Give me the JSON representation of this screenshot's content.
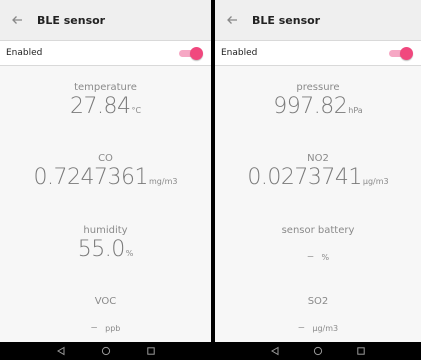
{
  "screens": [
    {
      "appbar": {
        "back_icon": "arrow-left-icon",
        "title": "BLE sensor"
      },
      "enabled": {
        "label": "Enabled",
        "state": "on"
      },
      "readings": [
        {
          "label": "temperature",
          "value": "27.84",
          "unit": "°C"
        },
        {
          "label": "CO",
          "value": "0.7247361",
          "unit": "mg/m3"
        },
        {
          "label": "humidity",
          "value": "55.0",
          "unit": "%"
        },
        {
          "label": "VOC",
          "value": "–",
          "unit": "ppb"
        }
      ]
    },
    {
      "appbar": {
        "back_icon": "arrow-left-icon",
        "title": "BLE sensor"
      },
      "enabled": {
        "label": "Enabled",
        "state": "on"
      },
      "readings": [
        {
          "label": "pressure",
          "value": "997.82",
          "unit": "hPa"
        },
        {
          "label": "NO2",
          "value": "0.0273741",
          "unit": "µg/m3"
        },
        {
          "label": "sensor battery",
          "value": "–",
          "unit": "%"
        },
        {
          "label": "SO2",
          "value": "–",
          "unit": "µg/m3"
        }
      ]
    }
  ],
  "colors": {
    "toggle_thumb": "#f0487e",
    "toggle_track": "#f6a7c4",
    "appbar_bg": "#efefef",
    "content_bg": "#f7f7f7",
    "navbar_bg": "#000000"
  },
  "navbar": {
    "icons": [
      "back-triangle-icon",
      "home-circle-icon",
      "recents-square-icon"
    ]
  }
}
